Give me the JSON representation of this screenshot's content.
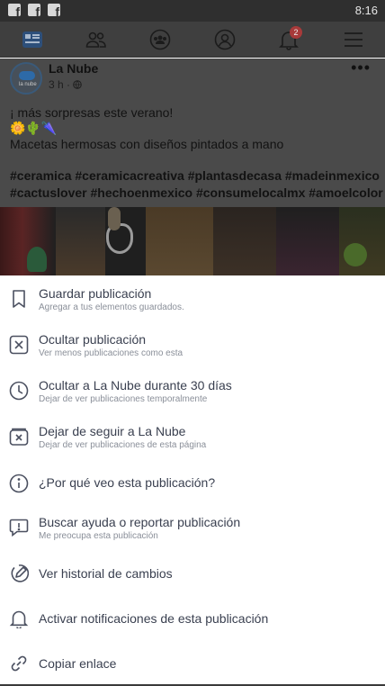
{
  "status_bar": {
    "time": "8:16",
    "notification_icons": [
      "facebook-icon",
      "facebook-icon",
      "facebook-icon"
    ]
  },
  "nav": {
    "items": [
      "news-feed-icon",
      "friends-icon",
      "groups-icon",
      "profile-icon",
      "notifications-icon",
      "menu-icon"
    ],
    "notification_badge": "2"
  },
  "post": {
    "page_name": "La Nube",
    "avatar_text": "la nube",
    "meta": "3 h ·",
    "more": "•••",
    "line1": "¡ más sorpresas este verano!",
    "line2": "🌼🌵🌂",
    "line3": "Macetas hermosas con diseños pintados a mano",
    "hashtags_line1": "#ceramica #ceramicacreativa #plantasdecasa #madeinmexico",
    "hashtags_line2": "#cactuslover #hechoenmexico #consumelocalmx #amoelcolor"
  },
  "menu": {
    "items": [
      {
        "icon": "bookmark-icon",
        "title": "Guardar publicación",
        "subtitle": "Agregar a tus elementos guardados."
      },
      {
        "icon": "hide-x-icon",
        "title": "Ocultar publicación",
        "subtitle": "Ver menos publicaciones como esta"
      },
      {
        "icon": "clock-icon",
        "title": "Ocultar a La Nube durante 30 días",
        "subtitle": "Dejar de ver publicaciones temporalmente"
      },
      {
        "icon": "unfollow-icon",
        "title": "Dejar de seguir a La Nube",
        "subtitle": "Dejar de ver publicaciones de esta página"
      },
      {
        "icon": "info-icon",
        "title": "¿Por qué veo esta publicación?",
        "subtitle": ""
      },
      {
        "icon": "report-icon",
        "title": "Buscar ayuda o reportar publicación",
        "subtitle": "Me preocupa esta publicación"
      },
      {
        "icon": "edit-history-icon",
        "title": "Ver historial de cambios",
        "subtitle": ""
      },
      {
        "icon": "bell-icon",
        "title": "Activar notificaciones de esta publicación",
        "subtitle": ""
      },
      {
        "icon": "link-icon",
        "title": "Copiar enlace",
        "subtitle": ""
      }
    ]
  }
}
